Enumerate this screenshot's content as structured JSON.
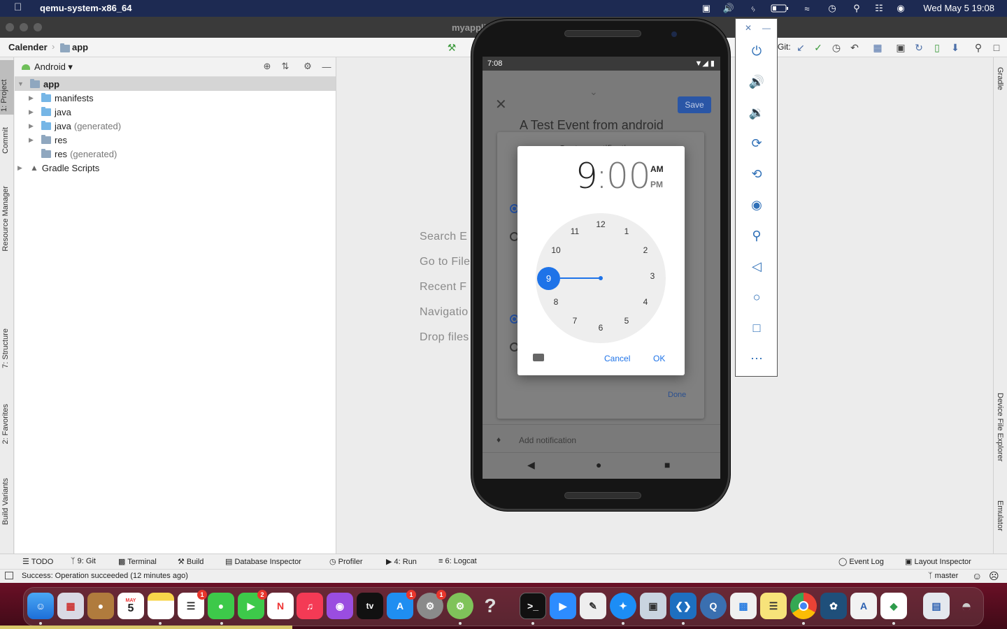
{
  "menubar": {
    "app_name": "qemu-system-x86_64",
    "clock": "Wed May 5  19:08"
  },
  "window": {
    "title": "myappli"
  },
  "toolbar": {
    "project": "Calender",
    "module": "app",
    "git_label": "Git:"
  },
  "left_tabs": [
    "1: Project",
    "Commit",
    "Resource Manager",
    "7: Structure",
    "2: Favorites",
    "Build Variants"
  ],
  "right_tabs": [
    "Gradle",
    "Device File Explorer",
    "Emulator"
  ],
  "project_panel": {
    "view": "Android",
    "tree": [
      {
        "label": "app",
        "generated": ""
      },
      {
        "label": "manifests",
        "generated": ""
      },
      {
        "label": "java",
        "generated": ""
      },
      {
        "label": "java",
        "generated": "(generated)"
      },
      {
        "label": "res",
        "generated": ""
      },
      {
        "label": "res",
        "generated": "(generated)"
      },
      {
        "label": "Gradle Scripts",
        "generated": ""
      }
    ]
  },
  "editor_hints": [
    "Search E",
    "Go to File",
    "Recent F",
    "Navigatio",
    "Drop files"
  ],
  "bottom_tabs": {
    "todo": "TODO",
    "git": "9: Git",
    "terminal": "Terminal",
    "build": "Build",
    "database": "Database Inspector",
    "profiler": "Profiler",
    "run": "4: Run",
    "logcat": "6: Logcat",
    "event_log": "Event Log",
    "layout_inspector": "Layout Inspector"
  },
  "status": {
    "message": "Success: Operation succeeded (12 minutes ago)",
    "branch": "master"
  },
  "phone": {
    "time": "7:08",
    "event_title": "A Test Event from android",
    "save": "Save",
    "custom_notification": "Custom notification",
    "done": "Done",
    "add_notification": "Add notification",
    "picker": {
      "hour": "9",
      "colon": ":",
      "minute": "00",
      "am": "AM",
      "pm": "PM",
      "selected": "9",
      "numbers": [
        "12",
        "1",
        "2",
        "3",
        "4",
        "5",
        "6",
        "7",
        "8",
        "10",
        "11"
      ],
      "cancel": "Cancel",
      "ok": "OK"
    }
  },
  "dock": {
    "calendar_month": "MAY",
    "calendar_day": "5",
    "reminders_badge": "1",
    "facetime_badge": "2",
    "appstore_badge": "1",
    "settings_badge": "1"
  },
  "colors": {
    "accent_blue": "#1e73e8",
    "menubar": "#1d2a52",
    "dock": "#5a0d20"
  }
}
